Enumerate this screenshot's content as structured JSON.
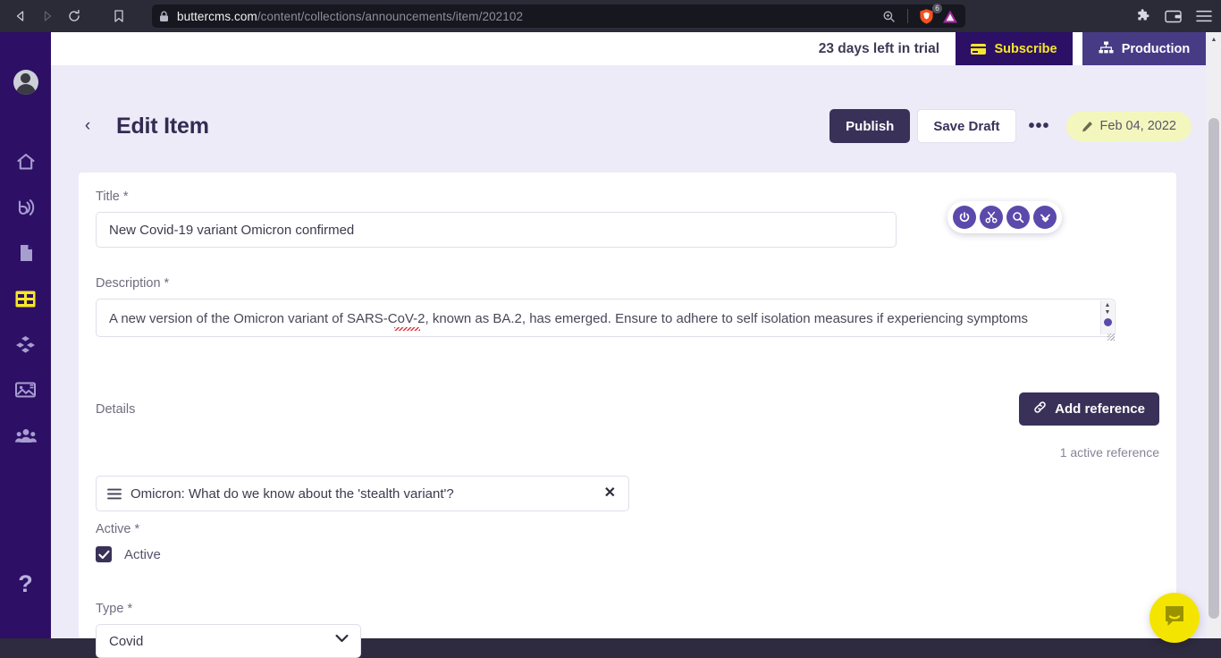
{
  "browser": {
    "url_host": "buttercms.com",
    "url_path": "/content/collections/announcements/item/202102",
    "shield_count": "6",
    "icons": {
      "back": "back-arrow-icon",
      "forward": "forward-arrow-icon",
      "reload": "reload-icon",
      "bookmark": "bookmark-icon",
      "lock": "lock-icon",
      "zoom": "zoom-search-icon",
      "brave_shield": "brave-lion-shield-icon",
      "brave_rewards": "brave-rewards-triangle-icon",
      "extensions": "puzzle-extensions-icon",
      "wallet": "wallet-icon",
      "menu": "hamburger-menu-icon"
    }
  },
  "sidebar": {
    "avatar": "user-avatar",
    "items": [
      {
        "name": "home",
        "icon": "home-icon",
        "active": false
      },
      {
        "name": "blog",
        "icon": "rss-blog-icon",
        "active": false
      },
      {
        "name": "pages",
        "icon": "page-document-icon",
        "active": false
      },
      {
        "name": "collections",
        "icon": "collections-grid-icon",
        "active": true
      },
      {
        "name": "components",
        "icon": "components-blocks-icon",
        "active": false
      },
      {
        "name": "media",
        "icon": "media-image-icon",
        "active": false
      },
      {
        "name": "team",
        "icon": "team-users-icon",
        "active": false
      }
    ],
    "help": "?"
  },
  "trial_bar": {
    "trial_text": "23 days left in trial",
    "subscribe_label": "Subscribe",
    "subscribe_icon": "credit-card-icon",
    "production_label": "Production",
    "production_icon": "sitemap-icon"
  },
  "header": {
    "back_chevron": "‹",
    "title": "Edit Item",
    "publish_label": "Publish",
    "save_draft_label": "Save Draft",
    "more_label": "•••",
    "date_badge": "Feb 04, 2022",
    "date_badge_icon": "pencil-edit-icon"
  },
  "form": {
    "title_field": {
      "label": "Title",
      "required": " *",
      "value": "New Covid-19 variant Omicron confirmed",
      "placeholder": ""
    },
    "description_field": {
      "label": "Description",
      "required": " *",
      "value": "A new version of the Omicron variant of SARS-CoV-2, known as BA.2, has emerged. Ensure to adhere to self isolation measures if experiencing symptoms",
      "placeholder": ""
    },
    "details_field": {
      "label": "Details",
      "add_reference_label": "Add reference",
      "add_reference_icon": "link-chain-icon",
      "active_reference_count": "1 active reference",
      "references": [
        {
          "title": "Omicron: What do we know about the 'stealth variant'?",
          "drag_icon": "drag-handle-icon",
          "remove_icon": "close-x-icon"
        }
      ]
    },
    "active_field": {
      "label": "Active",
      "required": " *",
      "checkbox_label": "Active",
      "checked": true
    },
    "type_field": {
      "label": "Type",
      "required": " *",
      "selected": "Covid",
      "chevron_icon": "chevron-down-icon"
    }
  },
  "float_toolbar": {
    "buttons": [
      {
        "name": "power-toggle-icon"
      },
      {
        "name": "scissors-cut-icon"
      },
      {
        "name": "search-magnifier-icon"
      },
      {
        "name": "chevron-double-down-icon"
      }
    ]
  },
  "intercom": {
    "icon": "chat-bubble-smile-icon"
  },
  "colors": {
    "brand_purple": "#2d0f66",
    "accent_yellow": "#f6e827",
    "publish_dark": "#3a3159",
    "badge_yellow": "#f4f7bd",
    "page_bg": "#edebf8",
    "intercom_yellow": "#f4e500"
  }
}
